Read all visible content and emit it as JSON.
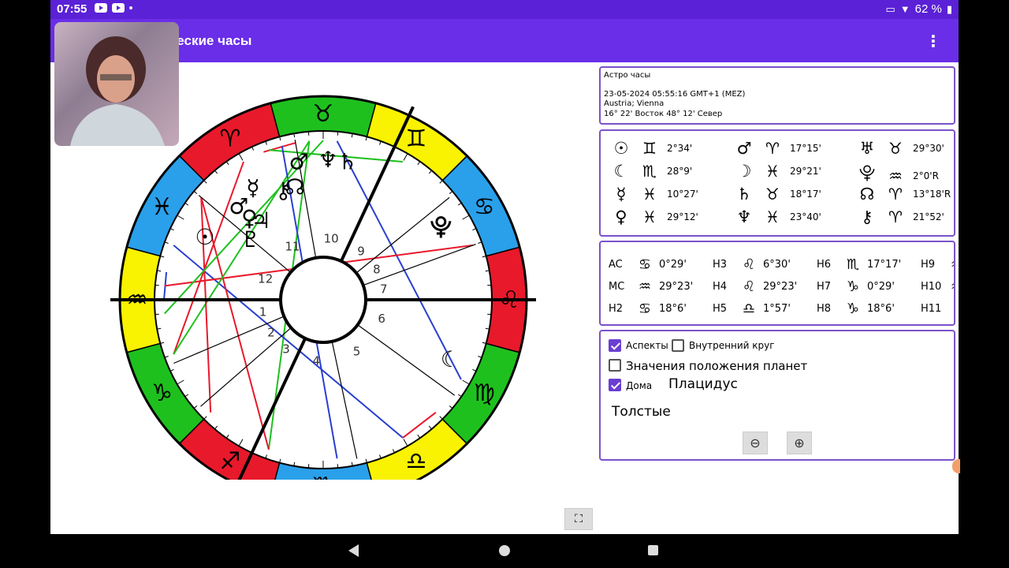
{
  "status": {
    "time": "07:55",
    "battery": "62 %"
  },
  "app": {
    "title": "неские часы"
  },
  "info": {
    "line1": "Астро часы",
    "line2": "23-05-2024 05:55:16 GMT+1 (MEZ)",
    "line3": "Austria; Vienna",
    "line4": "16° 22' Восток    48° 12' Север"
  },
  "planets": [
    {
      "planet": "☉",
      "sign": "♊",
      "value": "2°34'"
    },
    {
      "planet": "♂",
      "sign": "♈",
      "value": "17°15'"
    },
    {
      "planet": "♅",
      "sign": "♉",
      "value": "29°30'"
    },
    {
      "planet": "☾",
      "sign": "♏",
      "value": "28°9'"
    },
    {
      "planet": "☽",
      "sign": "♓",
      "value": "29°21'"
    },
    {
      "planet": "⯓",
      "sign": "♒",
      "value": "2°0'R"
    },
    {
      "planet": "☿",
      "sign": "♓",
      "value": "10°27'"
    },
    {
      "planet": "♄",
      "sign": "♉",
      "value": "18°17'"
    },
    {
      "planet": "☊",
      "sign": "♈",
      "value": "13°18'R"
    },
    {
      "planet": "♀",
      "sign": "♓",
      "value": "29°12'"
    },
    {
      "planet": "♆",
      "sign": "♓",
      "value": "23°40'"
    },
    {
      "planet": "⚷",
      "sign": "♈",
      "value": "21°52'"
    }
  ],
  "houses": [
    {
      "label": "AC",
      "sign": "♋",
      "value": "0°29'"
    },
    {
      "label": "H3",
      "sign": "♌",
      "value": "6°30'"
    },
    {
      "label": "H6",
      "sign": "♏",
      "value": "17°17'"
    },
    {
      "label": "H9",
      "sign": "♒",
      "value": ""
    },
    {
      "label": "MC",
      "sign": "♒",
      "value": "29°23'"
    },
    {
      "label": "H4",
      "sign": "♌",
      "value": "29°23'"
    },
    {
      "label": "H7",
      "sign": "♑",
      "value": "0°29'"
    },
    {
      "label": "H10",
      "sign": "♒",
      "value": ""
    },
    {
      "label": "H2",
      "sign": "♋",
      "value": "18°6'"
    },
    {
      "label": "H5",
      "sign": "♎",
      "value": "1°57'"
    },
    {
      "label": "H8",
      "sign": "♑",
      "value": "18°6'"
    },
    {
      "label": "H11",
      "sign": "-",
      "value": ""
    }
  ],
  "options": {
    "aspects": "Аспекты",
    "inner_circle": "Внутренний круг",
    "planet_values": "Значения положения планет",
    "houses": "Дома",
    "house_system": "Плацидус",
    "line_style": "Толстые"
  },
  "wheel": {
    "signs": [
      "♈",
      "♓",
      "♒",
      "♑",
      "♐",
      "♏",
      "♎",
      "♍",
      "♌",
      "♋",
      "♊",
      "♉"
    ],
    "sign_colors": [
      "#e8192b",
      "#2aa0ea",
      "#f9f200",
      "#1ec01e",
      "#e8192b",
      "#2aa0ea",
      "#f9f200",
      "#1ec01e",
      "#e8192b",
      "#2aa0ea",
      "#f9f200",
      "#1ec01e"
    ],
    "house_numbers": [
      "1",
      "2",
      "3",
      "4",
      "5",
      "6",
      "7",
      "8",
      "9",
      "10",
      "11",
      "12"
    ],
    "chart_planets": [
      {
        "glyph": "♂"
      },
      {
        "glyph": "♆"
      },
      {
        "glyph": "♄"
      },
      {
        "glyph": "☿"
      },
      {
        "glyph": "⚷"
      },
      {
        "glyph": "☊"
      },
      {
        "glyph": "♀"
      },
      {
        "glyph": "☉"
      },
      {
        "glyph": "♂"
      },
      {
        "glyph": "♃"
      },
      {
        "glyph": "⯓"
      },
      {
        "glyph": "☾"
      },
      {
        "glyph": "♇"
      }
    ]
  }
}
